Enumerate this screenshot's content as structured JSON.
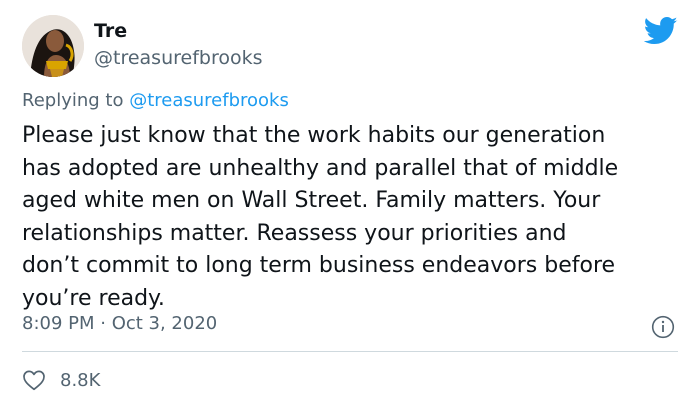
{
  "author": {
    "name": "Tre",
    "handle": "@treasurefbrooks",
    "avatar_icon": "profile-photo"
  },
  "reply": {
    "prefix": "Replying to ",
    "to_handle": "@treasurefbrooks"
  },
  "tweet": {
    "text": "Please just know that the work habits our generation\nhas adopted are unhealthy and parallel that of middle\naged white men on Wall Street. Family matters. Your\nrelationships matter. Reassess your priorities and\ndon’t commit to long term business endeavors before\nyou’re ready.",
    "timestamp": "8:09 PM · Oct 3, 2020"
  },
  "stats": {
    "likes": "8.8K"
  },
  "icons": {
    "brand": "twitter-bird-icon",
    "info": "info-icon",
    "like": "heart-icon"
  },
  "colors": {
    "brand": "#1d9bf0",
    "text": "#0f1419",
    "secondary": "#536471",
    "divider": "#cfd9de"
  }
}
